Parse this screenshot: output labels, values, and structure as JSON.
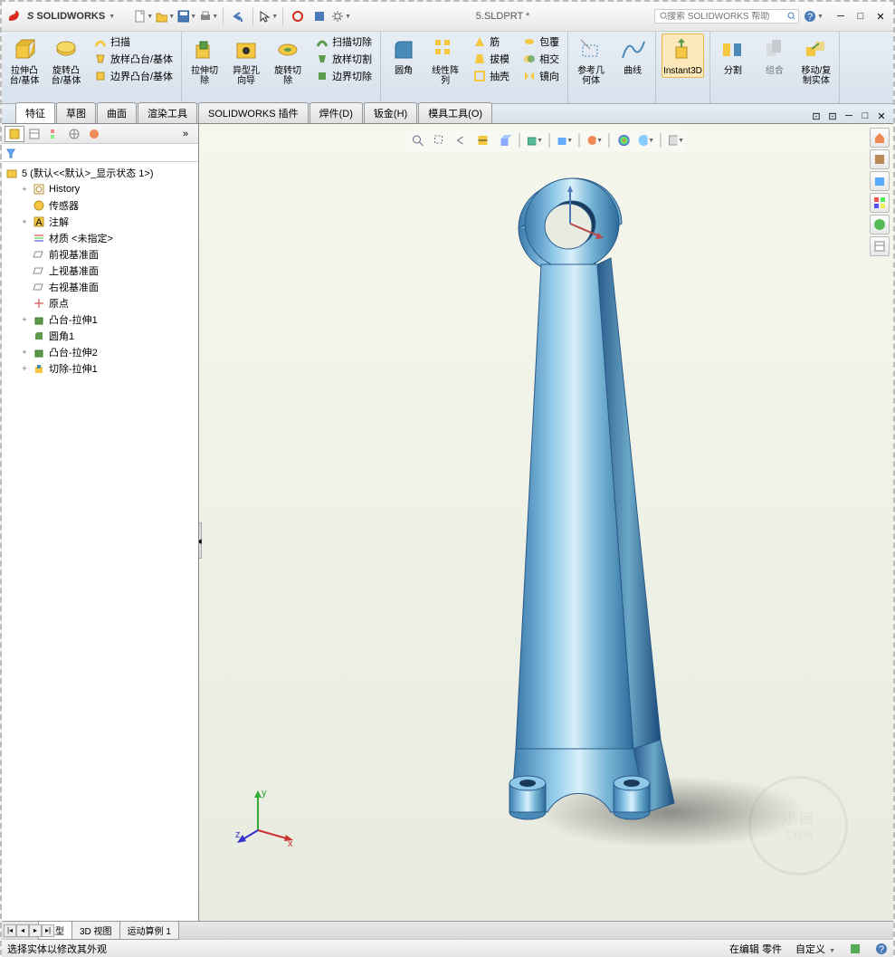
{
  "app": {
    "name": "SOLIDWORKS",
    "document": "5.SLDPRT *"
  },
  "search": {
    "placeholder": "搜索 SOLIDWORKS 帮助"
  },
  "ribbon": {
    "g1": {
      "extrude": "拉伸凸\n台/基体",
      "revolve": "旋转凸\n台/基体",
      "sweep": "扫描",
      "loft": "放样凸台/基体",
      "boundary": "边界凸台/基体"
    },
    "g2": {
      "cut_extrude": "拉伸切\n除",
      "hole": "异型孔\n向导",
      "cut_revolve": "旋转切\n除",
      "cut_sweep": "扫描切除",
      "cut_loft": "放样切割",
      "cut_boundary": "边界切除"
    },
    "g3": {
      "fillet": "圆角",
      "pattern": "线性阵\n列",
      "rib": "筋",
      "draft": "拔模",
      "shell": "抽壳",
      "wrap": "包覆",
      "intersect": "相交",
      "mirror": "镜向"
    },
    "g4": {
      "refgeom": "参考几\n何体",
      "curves": "曲线"
    },
    "g5": {
      "instant3d": "Instant3D"
    },
    "g6": {
      "split": "分割",
      "combine": "组合",
      "move": "移动/复\n制实体"
    }
  },
  "tabs": [
    "特征",
    "草图",
    "曲面",
    "渲染工具",
    "SOLIDWORKS 插件",
    "焊件(D)",
    "钣金(H)",
    "模具工具(O)"
  ],
  "tree": {
    "root": "5  (默认<<默认>_显示状态 1>)",
    "items": [
      {
        "icon": "history",
        "label": "History",
        "indent": 1,
        "expand": "+"
      },
      {
        "icon": "sensor",
        "label": "传感器",
        "indent": 1
      },
      {
        "icon": "annot",
        "label": "注解",
        "indent": 1,
        "expand": "+"
      },
      {
        "icon": "material",
        "label": "材质 <未指定>",
        "indent": 1
      },
      {
        "icon": "plane",
        "label": "前视基准面",
        "indent": 1
      },
      {
        "icon": "plane",
        "label": "上视基准面",
        "indent": 1
      },
      {
        "icon": "plane",
        "label": "右视基准面",
        "indent": 1
      },
      {
        "icon": "origin",
        "label": "原点",
        "indent": 1
      },
      {
        "icon": "feature",
        "label": "凸台-拉伸1",
        "indent": 1,
        "expand": "+"
      },
      {
        "icon": "fillet",
        "label": "圆角1",
        "indent": 1
      },
      {
        "icon": "feature",
        "label": "凸台-拉伸2",
        "indent": 1,
        "expand": "+"
      },
      {
        "icon": "cut",
        "label": "切除-拉伸1",
        "indent": 1,
        "expand": "+"
      }
    ]
  },
  "bottom_tabs": [
    "模型",
    "3D 视图",
    "运动算例 1"
  ],
  "status": {
    "left": "选择实体以修改其外观",
    "mode": "在编辑 零件",
    "custom": "自定义"
  },
  "triad": {
    "x": "x",
    "y": "y",
    "z": "z"
  },
  "watermark": "工程师"
}
